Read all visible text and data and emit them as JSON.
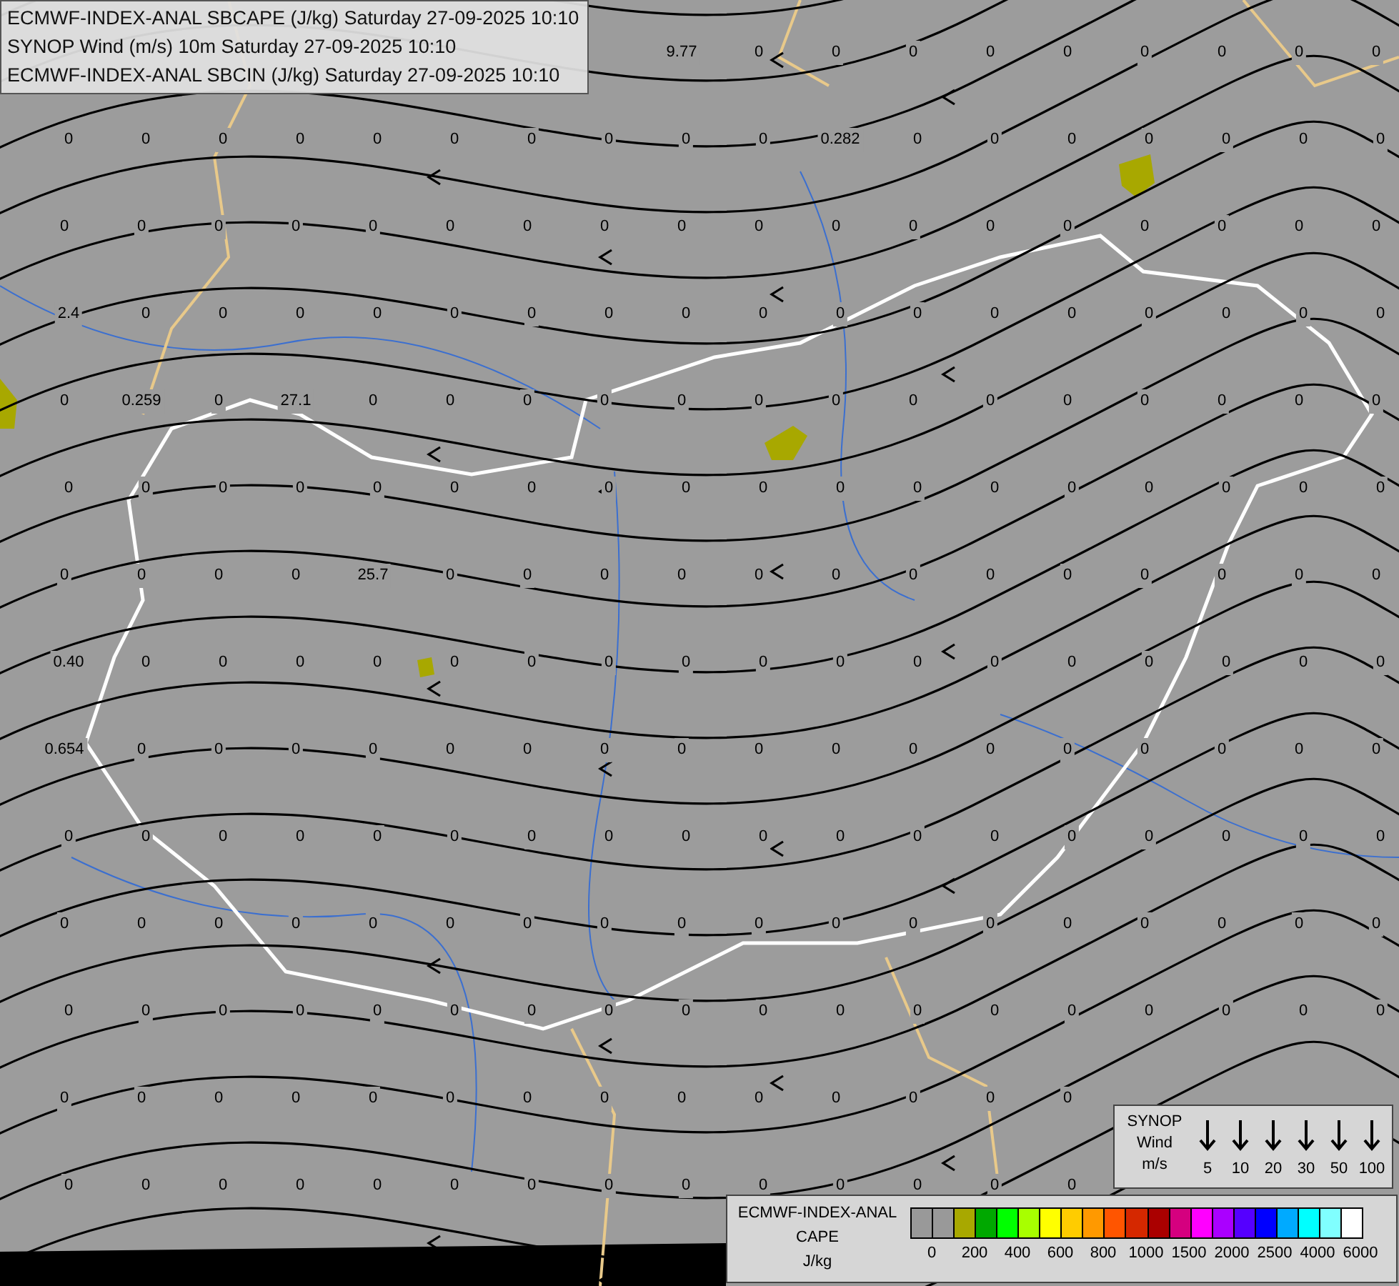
{
  "header": {
    "lines": [
      "ECMWF-INDEX-ANAL SBCAPE (J/kg) Saturday 27-09-2025 10:10",
      "SYNOP Wind (m/s) 10m Saturday 27-09-2025 10:10",
      "ECMWF-INDEX-ANAL SBCIN (J/kg) Saturday 27-09-2025 10:10"
    ]
  },
  "map": {
    "value_rows": [
      {
        "cells": [
          "9.77",
          "0",
          "0",
          "0",
          "0",
          "0",
          "0",
          "0",
          "0",
          "0"
        ]
      },
      {
        "cells": [
          "0",
          "0",
          "0",
          "0",
          "0",
          "0",
          "0",
          "0",
          "0",
          "0",
          "0.282",
          "0",
          "0",
          "0",
          "0",
          "0",
          "0",
          "0"
        ]
      },
      {
        "cells": [
          "0",
          "0",
          "0",
          "0",
          "0",
          "0",
          "0",
          "0",
          "0",
          "0",
          "0",
          "0",
          "0",
          "0",
          "0",
          "0",
          "0",
          "0"
        ]
      },
      {
        "cells": [
          "2.4",
          "0",
          "0",
          "0",
          "0",
          "0",
          "0",
          "0",
          "0",
          "0",
          "0",
          "0",
          "0",
          "0",
          "0",
          "0",
          "0",
          "0"
        ]
      },
      {
        "cells": [
          "0",
          "0.259",
          "0",
          "27.1",
          "0",
          "0",
          "0",
          "0",
          "0",
          "0",
          "0",
          "0",
          "0",
          "0",
          "0",
          "0",
          "0",
          "0"
        ]
      },
      {
        "cells": [
          "0",
          "0",
          "0",
          "0",
          "0",
          "0",
          "0",
          "0",
          "0",
          "0",
          "0",
          "0",
          "0",
          "0",
          "0",
          "0",
          "0",
          "0"
        ]
      },
      {
        "cells": [
          "0",
          "0",
          "0",
          "0",
          "25.7",
          "0",
          "0",
          "0",
          "0",
          "0",
          "0",
          "0",
          "0",
          "0",
          "0",
          "0",
          "0",
          "0"
        ]
      },
      {
        "cells": [
          "0.40",
          "0",
          "0",
          "0",
          "0",
          "0",
          "0",
          "0",
          "0",
          "0",
          "0",
          "0",
          "0",
          "0",
          "0",
          "0",
          "0",
          "0"
        ]
      },
      {
        "cells": [
          "0.654",
          "0",
          "0",
          "0",
          "0",
          "0",
          "0",
          "0",
          "0",
          "0",
          "0",
          "0",
          "0",
          "0",
          "0",
          "0",
          "0",
          "0"
        ]
      },
      {
        "cells": [
          "0",
          "0",
          "0",
          "0",
          "0",
          "0",
          "0",
          "0",
          "0",
          "0",
          "0",
          "0",
          "0",
          "0",
          "0",
          "0",
          "0",
          "0"
        ]
      },
      {
        "cells": [
          "0",
          "0",
          "0",
          "0",
          "0",
          "0",
          "0",
          "0",
          "0",
          "0",
          "0",
          "0",
          "0",
          "0",
          "0",
          "0",
          "0",
          "0"
        ]
      },
      {
        "cells": [
          "0",
          "0",
          "0",
          "0",
          "0",
          "0",
          "0",
          "0",
          "0",
          "0",
          "0",
          "0",
          "0",
          "0",
          "0",
          "0",
          "0",
          "0"
        ]
      },
      {
        "cells": [
          "0",
          "0",
          "0",
          "0",
          "0",
          "0",
          "0",
          "0",
          "0",
          "0",
          "0",
          "0",
          "0",
          "0"
        ]
      },
      {
        "cells": [
          "0",
          "0",
          "0",
          "0",
          "0",
          "0",
          "0",
          "0",
          "0",
          "0",
          "0",
          "0",
          "0",
          "0"
        ]
      }
    ]
  },
  "wind_legend": {
    "lines": [
      "SYNOP",
      "Wind",
      "m/s"
    ],
    "speeds": [
      "5",
      "10",
      "20",
      "30",
      "50",
      "100"
    ]
  },
  "cape_legend": {
    "lines": [
      "ECMWF-INDEX-ANAL",
      "CAPE",
      "J/kg"
    ],
    "swatches": [
      {
        "color": "#999999"
      },
      {
        "color": "#999999"
      },
      {
        "color": "#a8a800"
      },
      {
        "color": "#00a800"
      },
      {
        "color": "#00ff00"
      },
      {
        "color": "#a8ff00"
      },
      {
        "color": "#ffff00"
      },
      {
        "color": "#ffcc00"
      },
      {
        "color": "#ff9900"
      },
      {
        "color": "#ff5500"
      },
      {
        "color": "#d52800"
      },
      {
        "color": "#aa0000"
      },
      {
        "color": "#d5007f"
      },
      {
        "color": "#ff00ff"
      },
      {
        "color": "#aa00ff"
      },
      {
        "color": "#5500ff"
      },
      {
        "color": "#0000ff"
      },
      {
        "color": "#00aaff"
      },
      {
        "color": "#00ffff"
      },
      {
        "color": "#80ffff"
      },
      {
        "color": "#ffffff"
      }
    ],
    "ticks": [
      "0",
      "200",
      "400",
      "600",
      "800",
      "1000",
      "1500",
      "2000",
      "2500",
      "4000",
      "6000"
    ]
  }
}
